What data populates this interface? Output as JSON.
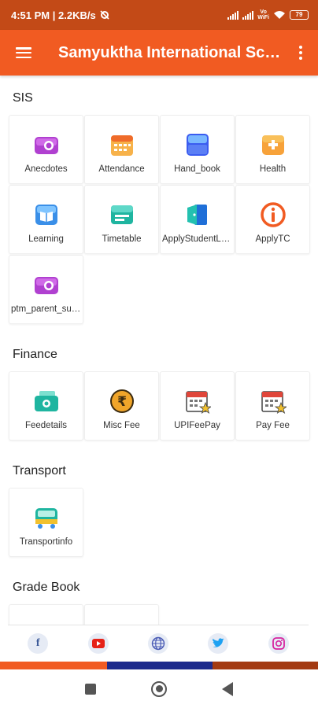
{
  "status_bar": {
    "time_speed": "4:51 PM | 2.2KB/s",
    "battery": "79"
  },
  "app_bar": {
    "title": "Samyuktha International School"
  },
  "sections": {
    "sis": {
      "title": "SIS",
      "tiles": [
        {
          "label": "Anecdotes",
          "icon": "camera-icon"
        },
        {
          "label": "Attendance",
          "icon": "calendar-icon"
        },
        {
          "label": "Hand_book",
          "icon": "book-icon"
        },
        {
          "label": "Health",
          "icon": "first-aid-icon"
        },
        {
          "label": "Learning",
          "icon": "open-book-icon"
        },
        {
          "label": "Timetable",
          "icon": "timetable-icon"
        },
        {
          "label": "ApplyStudentLeave",
          "icon": "door-exit-icon"
        },
        {
          "label": "ApplyTC",
          "icon": "info-icon"
        },
        {
          "label": "ptm_parent_survey",
          "icon": "camera-icon"
        }
      ]
    },
    "finance": {
      "title": "Finance",
      "tiles": [
        {
          "label": "Feedetails",
          "icon": "wallet-icon"
        },
        {
          "label": "Misc Fee",
          "icon": "rupee-coin-icon"
        },
        {
          "label": "UPIFeePay",
          "icon": "calendar-star-icon"
        },
        {
          "label": "Pay Fee",
          "icon": "calendar-star-icon"
        }
      ]
    },
    "transport": {
      "title": "Transport",
      "tiles": [
        {
          "label": "Transportinfo",
          "icon": "bus-icon"
        }
      ]
    },
    "grade_book": {
      "title": "Grade Book"
    }
  },
  "social": [
    "facebook-icon",
    "youtube-icon",
    "globe-icon",
    "twitter-icon",
    "instagram-icon"
  ],
  "colors": {
    "status_bar": "#c34a17",
    "app_bar": "#f15b22",
    "stripe_orange": "#f15b22",
    "stripe_blue": "#1c2a8c",
    "stripe_brown": "#a33a12"
  }
}
